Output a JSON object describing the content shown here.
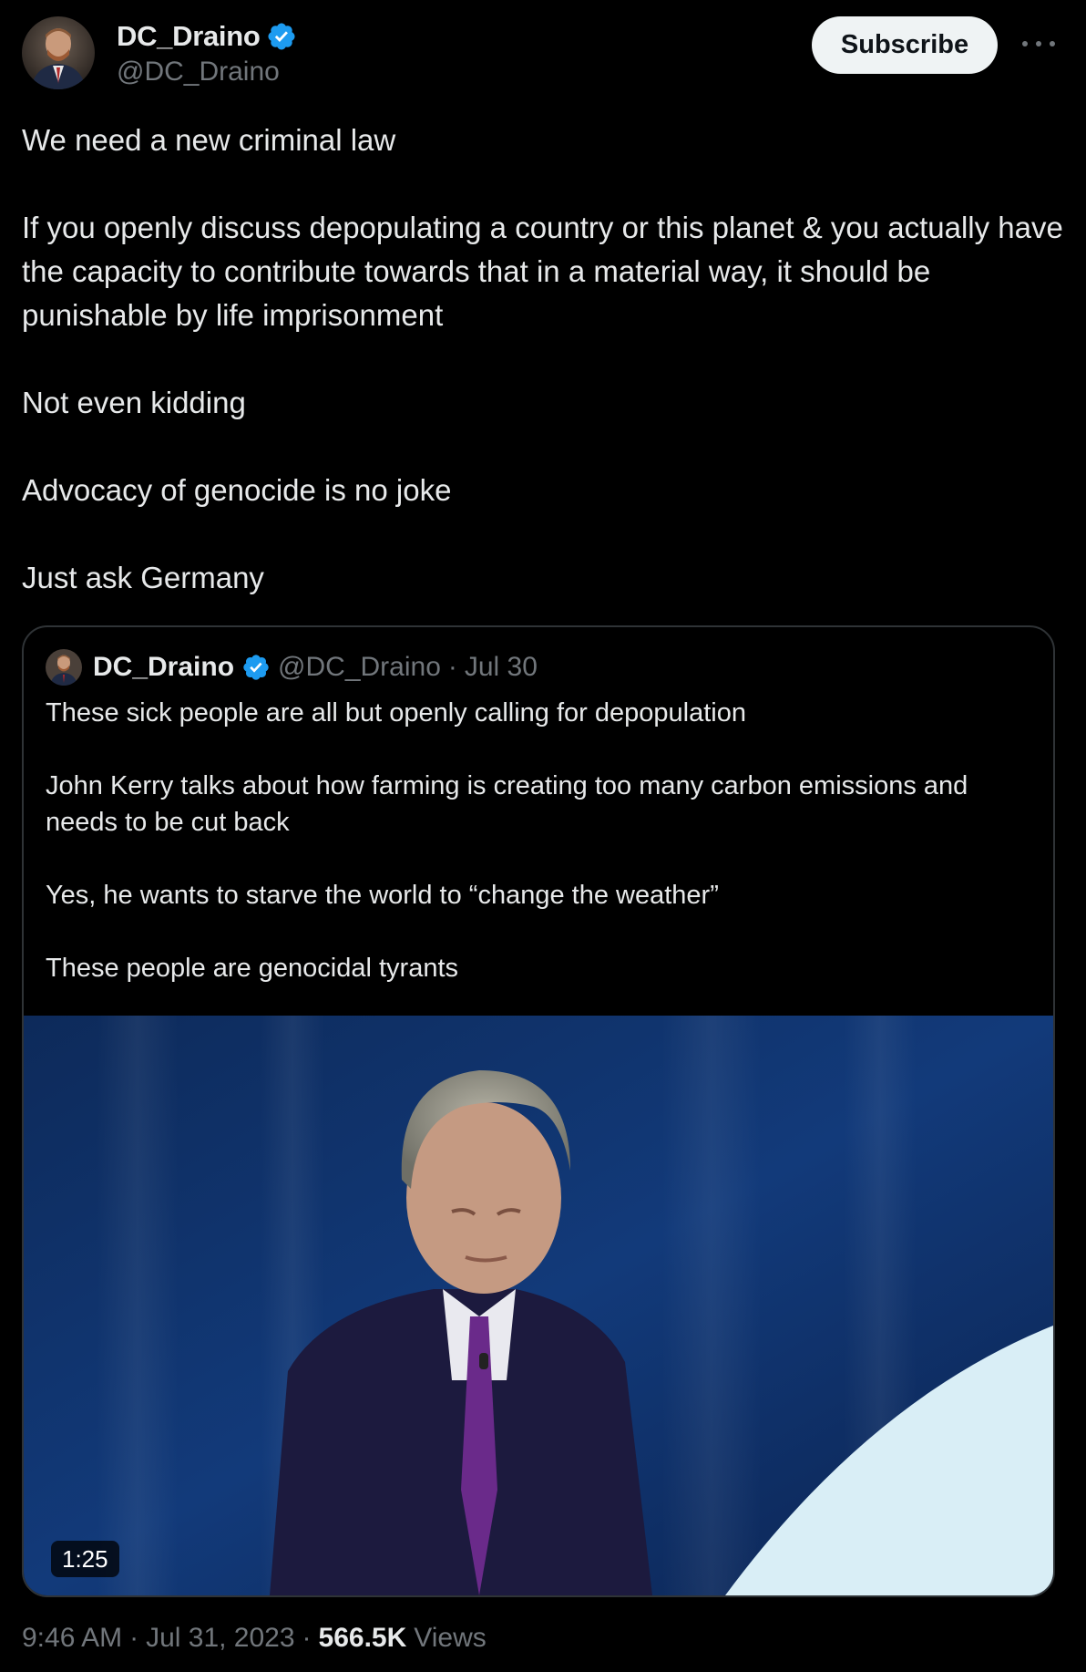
{
  "author": {
    "display_name": "DC_Draino",
    "handle": "@DC_Draino",
    "verified": true,
    "verified_color": "#1d9bf0"
  },
  "actions": {
    "subscribe_label": "Subscribe",
    "more_icon": "more-horizontal-icon"
  },
  "tweet": {
    "paragraphs": [
      "We need a new criminal law",
      "If you openly discuss depopulating a country or this planet & you actually have the capacity to contribute towards that in a material way, it should be punishable by life imprisonment",
      "Not even kidding",
      "Advocacy of genocide is no joke",
      "Just ask Germany"
    ]
  },
  "quote": {
    "display_name": "DC_Draino",
    "handle": "@DC_Draino",
    "separator": "·",
    "date": "Jul 30",
    "paragraphs": [
      "These sick people are all but openly calling for depopulation",
      "John Kerry talks about how farming is creating too many carbon emissions and needs to be cut back",
      "Yes, he wants to starve the world to “change the weather”",
      "These people are genocidal tyrants"
    ],
    "video_duration": "1:25"
  },
  "meta": {
    "time": "9:46 AM",
    "separator": "·",
    "date": "Jul 31, 2023",
    "views_count": "566.5K",
    "views_label": "Views"
  },
  "colors": {
    "background": "#000000",
    "text_primary": "#e7e9ea",
    "text_secondary": "#71767b",
    "border": "#2f3336",
    "button_bg": "#eff3f4"
  }
}
